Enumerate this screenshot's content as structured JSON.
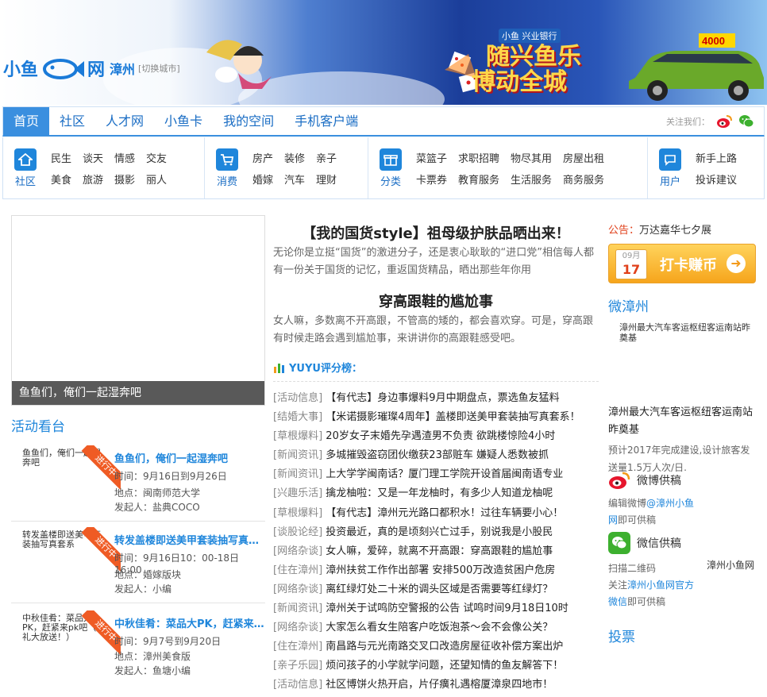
{
  "header": {
    "logo_main": "小鱼",
    "logo_net": "网",
    "logo_domain": "xiaoyu.com",
    "city": "漳州",
    "switch_city": "[切换城市]",
    "promo_tag": "小鱼 兴业银行",
    "promo_line1": "随兴鱼乐",
    "promo_line2": "博动全城",
    "promo_price": "4000"
  },
  "nav": {
    "items": [
      "首页",
      "社区",
      "人才网",
      "小鱼卡",
      "我的空间",
      "手机客户端"
    ],
    "active": "首页",
    "follow_label": "关注我们："
  },
  "categories": [
    {
      "label": "社区",
      "icon": "house-icon",
      "links": [
        "民生",
        "美食",
        "谈天",
        "旅游",
        "情感",
        "摄影",
        "交友",
        "丽人"
      ]
    },
    {
      "label": "消费",
      "icon": "cart-icon",
      "links": [
        "房产",
        "婚嫁",
        "装修",
        "汽车",
        "亲子",
        "理财"
      ]
    },
    {
      "label": "分类",
      "icon": "gift-icon",
      "links": [
        "菜篮子",
        "卡票券",
        "求职招聘",
        "教育服务",
        "物尽其用",
        "生活服务",
        "房屋出租",
        "商务服务"
      ]
    },
    {
      "label": "用户",
      "icon": "user-icon",
      "links": [
        "新手上路",
        "投诉建议"
      ]
    }
  ],
  "featured": {
    "caption": "鱼鱼们，俺们一起湿奔吧"
  },
  "activities": {
    "title": "活动看台",
    "ribbon": "进行中",
    "items": [
      {
        "thumb": "鱼鱼们，俺们一起湿奔吧",
        "title": "鱼鱼们，俺们一起湿奔吧",
        "time": "时间：9月16日到9月26日",
        "place": "地点：闽南师范大学",
        "host": "发起人：盐典COCO"
      },
      {
        "thumb": "转发盖楼即送美甲套装抽写真套系",
        "title": "转发盖楼即送美甲套装抽写真套系",
        "time": "时间：9月16日10：00-18日16:00",
        "place": "地点：婚嫁版块",
        "host": "发起人：小编"
      },
      {
        "thumb": "中秋佳肴：菜品大PK，赶紧来pk吧（好礼大放送！）",
        "title": "中秋佳肴：菜品大PK，赶紧来pk吧",
        "time": "时间：9月7号到9月20日",
        "place": "地点：漳州美食版",
        "host": "发起人：鱼塘小编"
      }
    ]
  },
  "articles": [
    {
      "title": "【我的国货style】祖母级护肤品晒出来！",
      "summary": "无论你是立挺“国货”的激进分子，还是衷心耿耿的“进口党”相信每人都有一份关于国货的记忆，重返国货精品，晒出那些年你用"
    },
    {
      "title": "穿高跟鞋的尴尬事",
      "summary": "女人嘛，多数离不开高跟，不管高的矮的，都会喜欢穿。可是，穿高跟有时候走路会遇到尴尬事，来讲讲你的高跟鞋感受吧。"
    }
  ],
  "rating": {
    "label": "YUYU评分榜："
  },
  "news": [
    {
      "tag": "[活动信息]",
      "title": "【有代志】身边事爆料9月中期盘点，票选鱼友猛料"
    },
    {
      "tag": "[结婚大事]",
      "title": "【米诺摄影璀璨4周年】盖楼即送美甲套装抽写真套系！"
    },
    {
      "tag": "[草根爆料]",
      "title": "20岁女子末婚先孕遇渣男不负责 欲跳楼惊险4小时"
    },
    {
      "tag": "[新闻资讯]",
      "title": "多城摧毁盗窃团伙缴获23部赃车 嫌疑人悉数被抓"
    },
    {
      "tag": "[新闻资讯]",
      "title": "上大学学闽南话？厦门理工学院开设首届闽南语专业"
    },
    {
      "tag": "[兴趣乐活]",
      "title": "擒龙柚啦：又是一年龙柚时，有多少人知道龙柚呢"
    },
    {
      "tag": "[草根爆料]",
      "title": "【有代志】漳州元光路口都积水！过往车辆要小心！"
    },
    {
      "tag": "[谈股论经]",
      "title": "投资最近，真的是顷刻兴亡过手，别说我是小股民"
    },
    {
      "tag": "[网络杂谈]",
      "title": "女人嘛，爱碎，就离不开高跟：穿高跟鞋的尴尬事"
    },
    {
      "tag": "[住在漳州]",
      "title": "漳州扶贫工作作出部署 安排500万改造贫困户危房"
    },
    {
      "tag": "[网络杂谈]",
      "title": "离红绿灯处二十米的调头区域是否需要等红绿灯？"
    },
    {
      "tag": "[新闻资讯]",
      "title": "漳州关于试鸣防空警报的公告 试鸣时间9月18日10时"
    },
    {
      "tag": "[网络杂谈]",
      "title": "大家怎么看女生陪客户吃饭泡茶～会不会像公关？"
    },
    {
      "tag": "[住在漳州]",
      "title": "南昌路与元光南路交叉口改造房屋征收补偿方案出炉"
    },
    {
      "tag": "[亲子乐园]",
      "title": "烦问孩子的小学就学问题，还望知情的鱼友解答下！"
    },
    {
      "tag": "[活动信息]",
      "title": "社区博饼火热开启，片仔癀礼遇榕厦漳泉四地市！"
    }
  ],
  "sidebar": {
    "notice_label": "公告：",
    "notice_text": "万达嘉华七夕展",
    "checkin_month": "09月",
    "checkin_day": "17",
    "checkin_label": "打卡赚币",
    "weibo_title": "微漳州",
    "weibo_embed": "漳州最大汽车客运枢纽客运南站昨奠基",
    "weibo_post": "漳州最大汽车客运枢纽客运南站昨奠基",
    "weibo_desc": "预计2017年完成建设,设计旅客发送量1.5万人次/日.",
    "weibo_supply_title": "微博供稿",
    "weibo_supply_pre": "编辑微博",
    "weibo_supply_link": "@漳州小鱼网",
    "weibo_supply_post": "即可供稿",
    "wechat_supply_title": "微信供稿",
    "wechat_line1": "扫描二维码",
    "wechat_pre": "关注",
    "wechat_link": "漳州小鱼网官方微信",
    "wechat_post": "即可供稿",
    "wechat_name": "漳州小鱼网",
    "submit_label": "投票"
  },
  "colors": {
    "brand_blue": "#1f86db",
    "nav_active": "#3a8fdf",
    "ribbon": "#ef5b24",
    "notice": "#e0401b"
  }
}
